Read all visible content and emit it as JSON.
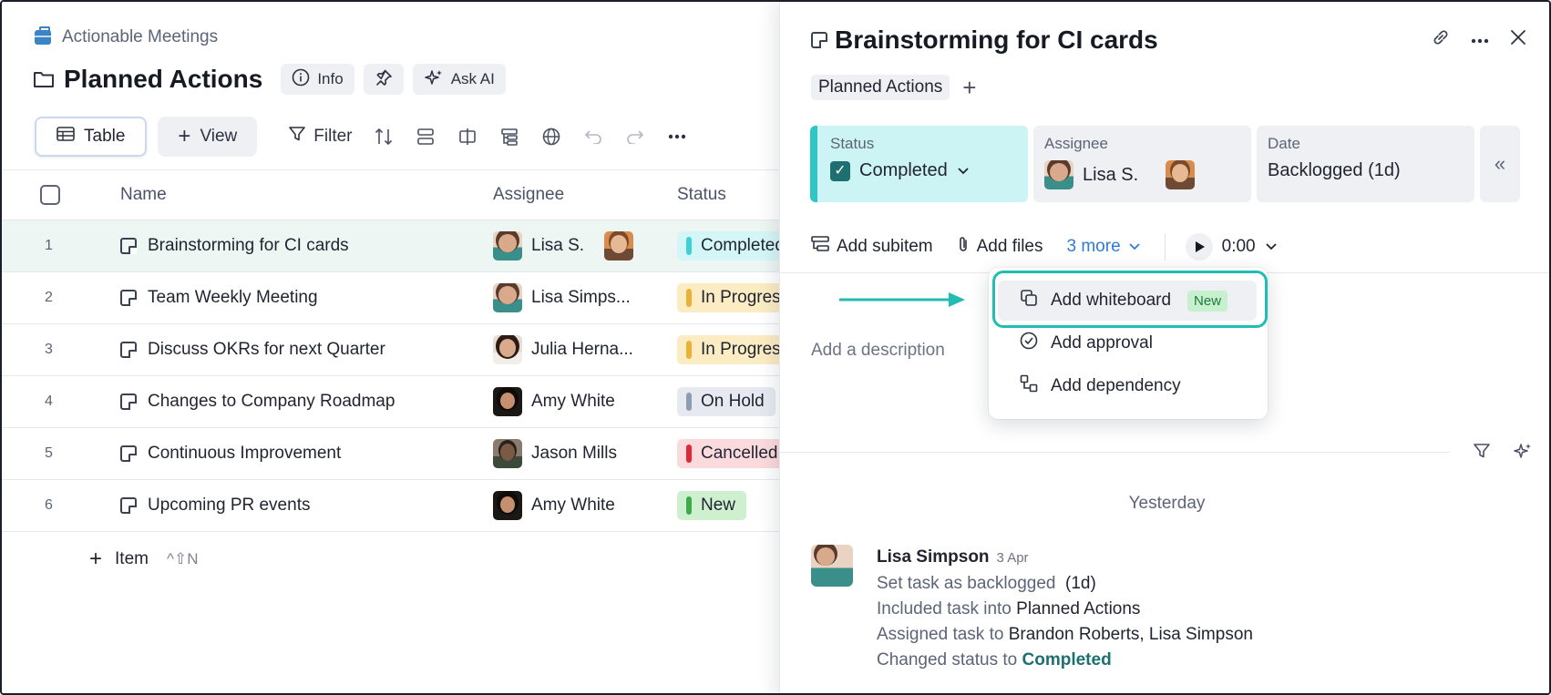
{
  "left": {
    "breadcrumb": "Actionable Meetings",
    "title": "Planned Actions",
    "info_label": "Info",
    "ask_ai_label": "Ask AI",
    "toolbar": {
      "table_label": "Table",
      "view_label": "View",
      "filter_label": "Filter"
    },
    "columns": {
      "name": "Name",
      "assignee": "Assignee",
      "status": "Status"
    },
    "rows": [
      {
        "num": "1",
        "name": "Brainstorming for CI cards",
        "assignee": "Lisa S.",
        "status": "Completed",
        "status_color": "#3ed3d3",
        "status_bg": "#d5f6f6"
      },
      {
        "num": "2",
        "name": "Team Weekly Meeting",
        "assignee": "Lisa Simps...",
        "status": "In Progress",
        "status_color": "#e9b234",
        "status_bg": "#fbecc4"
      },
      {
        "num": "3",
        "name": "Discuss OKRs for next Quarter",
        "assignee": "Julia Herna...",
        "status": "In Progress",
        "status_color": "#e9b234",
        "status_bg": "#fbecc4"
      },
      {
        "num": "4",
        "name": "Changes to Company Roadmap",
        "assignee": "Amy White",
        "status": "On Hold",
        "status_color": "#8f9bb0",
        "status_bg": "#e6eaf0"
      },
      {
        "num": "5",
        "name": "Continuous Improvement",
        "assignee": "Jason Mills",
        "status": "Cancelled",
        "status_color": "#e2263a",
        "status_bg": "#fbdadd"
      },
      {
        "num": "6",
        "name": "Upcoming PR events",
        "assignee": "Amy White",
        "status": "New",
        "status_color": "#3faa4c",
        "status_bg": "#cff0cf"
      }
    ],
    "add_item_label": "Item",
    "add_item_shortcut": "^⇧N"
  },
  "panel": {
    "title": "Brainstorming for CI cards",
    "tag": "Planned Actions",
    "fields": {
      "status_label": "Status",
      "status_value": "Completed",
      "assignee_label": "Assignee",
      "assignee_value": "Lisa S.",
      "date_label": "Date",
      "date_value": "Backlogged (1d)"
    },
    "subbar": {
      "add_subitem": "Add subitem",
      "add_files": "Add files",
      "more": "3 more",
      "timer": "0:00"
    },
    "description_placeholder": "Add a description",
    "menu": {
      "add_whiteboard": "Add whiteboard",
      "new_badge": "New",
      "add_approval": "Add approval",
      "add_dependency": "Add dependency"
    },
    "feed": {
      "day": "Yesterday",
      "author": "Lisa Simpson",
      "date": "3 Apr",
      "line1_prefix": "Set task as backlogged",
      "line1_value": "(1d)",
      "line2_prefix": "Included task into",
      "line2_value": "Planned Actions",
      "line3_prefix": "Assigned task to",
      "line3_value": "Brandon Roberts, Lisa Simpson",
      "line4_prefix": "Changed status to",
      "line4_value": "Completed"
    }
  },
  "colors": {
    "accent_teal": "#21bdb3",
    "link_blue": "#2f7bd6"
  }
}
